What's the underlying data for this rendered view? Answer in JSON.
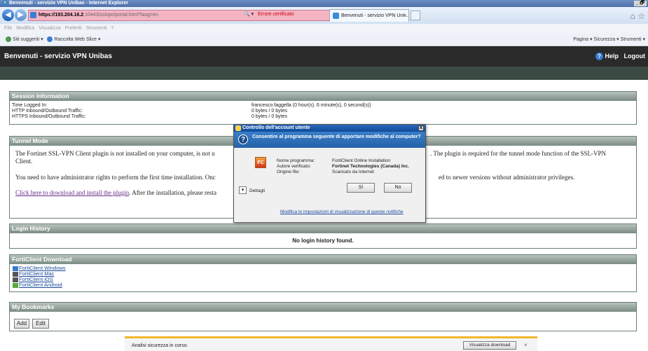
{
  "browser": {
    "window_title": "Benvenuti - servizio VPN Unibas - Internet Explorer",
    "window_controls": "_ 🗗",
    "url_host": "https://193.204.16.2",
    "url_rest": ":10443/sslvpn/portal.html?lang=en",
    "addr_tools": "🔍 ▾",
    "cert_error": "Errore certificato",
    "tab_title": "Benvenuti - servizio VPN Uni...",
    "tab_close": "×",
    "home_star": "⌂ ☆",
    "menu": "File  Modifica  Visualizza  Preferiti  Strumenti  ?",
    "fav_suggested": "Siti suggeriti ▾",
    "fav_gallery": "Raccolta Web Slice ▾",
    "command_bar": "Pagina ▾   Sicurezza ▾   Strumenti ▾"
  },
  "vpn": {
    "title": "Benvenuti - servizio VPN Unibas",
    "help_icon": "?",
    "help": "Help",
    "logout": "Logout"
  },
  "session": {
    "heading": "Session Information",
    "rows": [
      {
        "label": "Time Logged In:",
        "value": "francesco.faggella (0 hour(s), 6 minute(s), 0 second(s))"
      },
      {
        "label": "HTTP Inbound/Outbound Traffic:",
        "value": "0 bytes / 0 bytes"
      },
      {
        "label": "HTTPS Inbound/Outbound Traffic:",
        "value": "0 bytes / 0 bytes"
      }
    ]
  },
  "tunnel": {
    "heading": "Tunnel Mode",
    "p1_start": "The Fortinet SSL-VPN Client plugin is not installed on your computer, is not u",
    "p1_end": ". The plugin is required for the tunnel mode function of the SSL-VPN",
    "p1_line2": "Client.",
    "p2_start": "You need to have administrator rights to perform the first time installation. Onc",
    "p2_end": "ed to newer versions without administrator privileges.",
    "link": "Click here to download and install the plugin",
    "after_link": ". After the installation, please resta"
  },
  "login": {
    "heading": "Login History",
    "empty": "No login history found."
  },
  "downloads": {
    "heading": "FortiClient Download",
    "items": [
      "FortiClient Windows",
      "FortiClient Mac",
      "FortiClient iOS",
      "FortiClient Android"
    ]
  },
  "bookmarks": {
    "heading": "My Bookmarks",
    "add": "Add",
    "edit": "Edit"
  },
  "uac": {
    "title": "Controllo dell'account utente",
    "close": "x",
    "question": "Consentire al programma seguente di apportare modifiche al computer?",
    "rows": [
      {
        "label": "Nome programma:",
        "value": "FortiClient Online Installation"
      },
      {
        "label": "Autore verificato:",
        "value": "Fortinet Technologies (Canada) Inc."
      },
      {
        "label": "Origine file:",
        "value": "Scaricato da Internet"
      }
    ],
    "details": "Dettagli",
    "yes": "Sì",
    "no": "No",
    "change_link": "Modifica le impostazioni di visualizzazione di queste notifiche"
  },
  "notification": {
    "text": "Analisi sicurezza in corso.",
    "button": "Visualizza download",
    "close": "×"
  }
}
